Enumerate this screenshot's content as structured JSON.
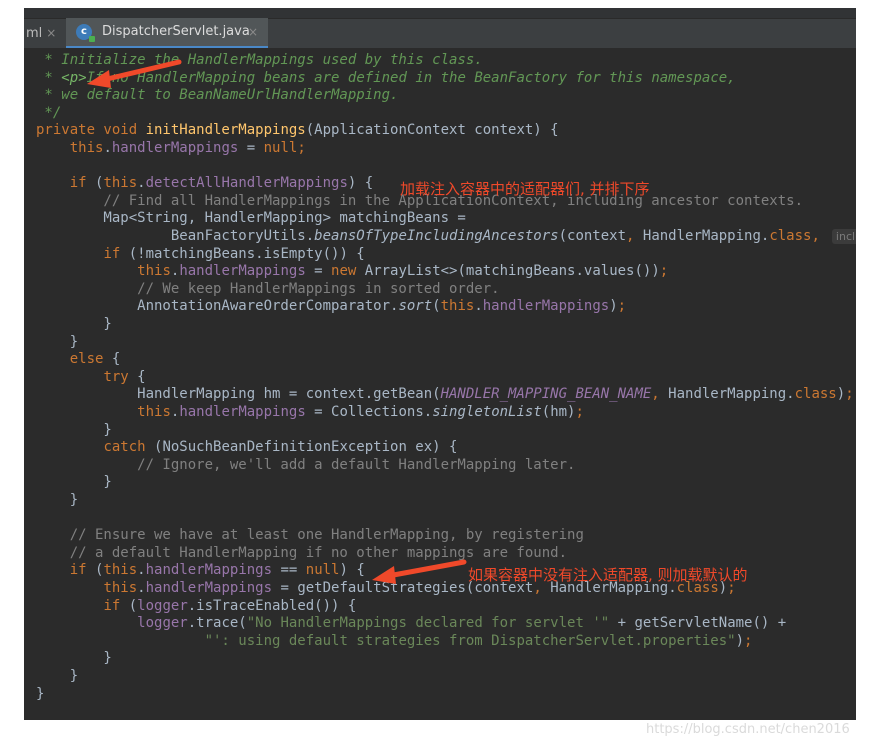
{
  "tabs": {
    "previous_label": "ml",
    "active_label": "DispatcherServlet.java",
    "close_glyph": "×",
    "active_icon": "java-class-icon"
  },
  "code": {
    "l1": {
      "a": " * Initialize the HandlerMappings used by this class."
    },
    "l2": {
      "a": " * ",
      "b": "<p>",
      "c": "If no HandlerMapping beans are defined in the BeanFactory for this namespace,"
    },
    "l3": {
      "a": " * we default to BeanNameUrlHandlerMapping."
    },
    "l4": {
      "a": " */"
    },
    "l5": {
      "a": "private void ",
      "b": "initHandlerMappings",
      "c": "(ApplicationContext context) {"
    },
    "l6": {
      "a": "    ",
      "b": "this",
      "c": ".",
      "d": "handlerMappings",
      "e": " = ",
      "f": "null",
      "g": ";"
    },
    "l8": {
      "a": "    ",
      "b": "if ",
      "c": "(",
      "d": "this",
      "e": ".",
      "f": "detectAllHandlerMappings",
      "g": ") {"
    },
    "l9": {
      "a": "        // Find all HandlerMappings in the ApplicationContext, including ancestor contexts."
    },
    "l10": {
      "a": "        Map<String, HandlerMapping> matchingBeans ="
    },
    "l11": {
      "a": "                BeanFactoryUtils.",
      "b": "beansOfTypeIncludingAncestors",
      "c": "(context",
      "d": ", ",
      "e": "HandlerMapping.",
      "f": "class",
      "g": ",",
      "hint": "include"
    },
    "l12": {
      "a": "        ",
      "b": "if ",
      "c": "(!matchingBeans.isEmpty()) {"
    },
    "l13": {
      "a": "            ",
      "b": "this",
      "c": ".",
      "d": "handlerMappings",
      "e": " = ",
      "f": "new ",
      "g": "ArrayList<>(matchingBeans.values())",
      "h": ";"
    },
    "l14": {
      "a": "            // We keep HandlerMappings in sorted order."
    },
    "l15": {
      "a": "            AnnotationAwareOrderComparator.",
      "b": "sort",
      "c": "(",
      "d": "this",
      "e": ".",
      "f": "handlerMappings",
      "g": ")",
      "h": ";"
    },
    "l16": {
      "a": "        }"
    },
    "l17": {
      "a": "    }"
    },
    "l18": {
      "a": "    ",
      "b": "else ",
      "c": "{"
    },
    "l19": {
      "a": "        ",
      "b": "try ",
      "c": "{"
    },
    "l20": {
      "a": "            HandlerMapping hm = context.getBean(",
      "b": "HANDLER_MAPPING_BEAN_NAME",
      "c": ", ",
      "d": "HandlerMapping.",
      "e": "class",
      "f": ")",
      "g": ";"
    },
    "l21": {
      "a": "            ",
      "b": "this",
      "c": ".",
      "d": "handlerMappings",
      "e": " = Collections.",
      "f": "singletonList",
      "g": "(hm)",
      "h": ";"
    },
    "l22": {
      "a": "        }"
    },
    "l23": {
      "a": "        ",
      "b": "catch ",
      "c": "(NoSuchBeanDefinitionException ex) {"
    },
    "l24": {
      "a": "            // Ignore, we'll add a default HandlerMapping later."
    },
    "l25": {
      "a": "        }"
    },
    "l26": {
      "a": "    }"
    },
    "l28": {
      "a": "    // Ensure we have at least one HandlerMapping, by registering"
    },
    "l29": {
      "a": "    // a default HandlerMapping if no other mappings are found."
    },
    "l30": {
      "a": "    ",
      "b": "if ",
      "c": "(",
      "d": "this",
      "e": ".",
      "f": "handlerMappings",
      "g": " == ",
      "h": "null",
      "i": ") {"
    },
    "l31": {
      "a": "        ",
      "b": "this",
      "c": ".",
      "d": "handlerMappings",
      "e": " = getDefaultStrategies(context",
      "f": ", ",
      "g": "HandlerMapping.",
      "h": "class",
      "i": ")",
      "j": ";"
    },
    "l32": {
      "a": "        ",
      "b": "if ",
      "c": "(",
      "d": "logger",
      "e": ".isTraceEnabled()) {"
    },
    "l33": {
      "a": "            ",
      "b": "logger",
      "c": ".trace(",
      "d": "\"No HandlerMappings declared for servlet '\"",
      "e": " + getServletName() +"
    },
    "l34": {
      "a": "                    ",
      "b": "\"': using default strategies from DispatcherServlet.properties\"",
      "c": ")",
      "d": ";"
    },
    "l35": {
      "a": "        }"
    },
    "l36": {
      "a": "    }"
    },
    "l37": {
      "a": "}"
    }
  },
  "annotations": {
    "note1": "加载注入容器中的适配器们, 并排下序",
    "note2": "如果容器中没有注入适配器, 则加载默认的",
    "color": "#f0492a"
  },
  "watermark": "https://blog.csdn.net/chen2016"
}
